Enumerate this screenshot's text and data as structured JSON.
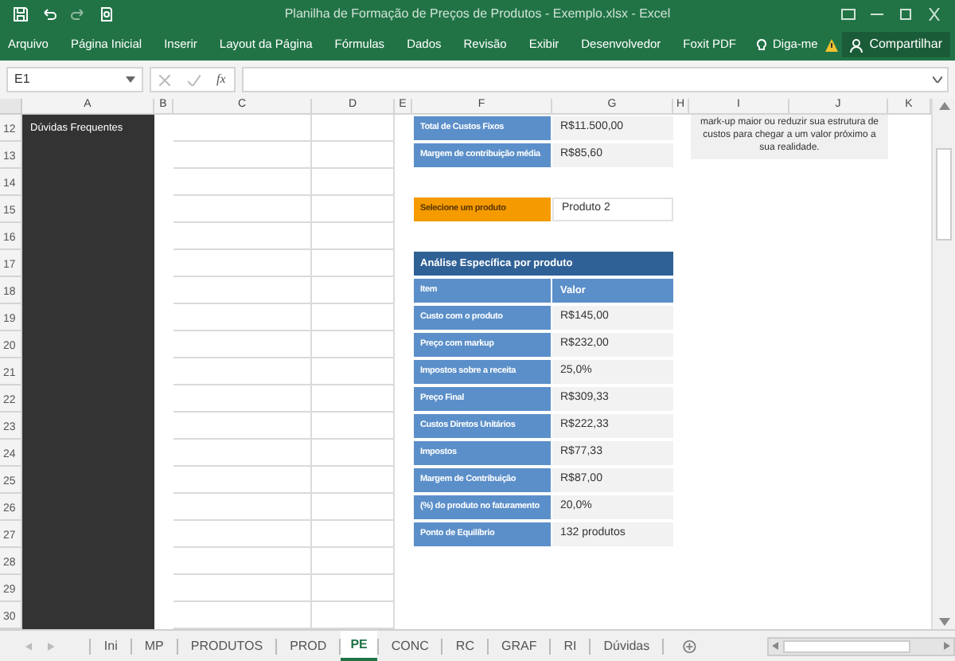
{
  "window": {
    "title": "Planilha de Formação de Preços de Produtos - Exemplo.xlsx - Excel"
  },
  "ribbon_tabs": [
    {
      "label": "Arquivo"
    },
    {
      "label": "Página Inicial"
    },
    {
      "label": "Inserir"
    },
    {
      "label": "Layout da Página"
    },
    {
      "label": "Fórmulas"
    },
    {
      "label": "Dados"
    },
    {
      "label": "Revisão"
    },
    {
      "label": "Exibir"
    },
    {
      "label": "Desenvolvedor"
    },
    {
      "label": "Foxit PDF"
    }
  ],
  "tell_me": "Diga-me",
  "share": "Compartilhar",
  "name_box": "E1",
  "fx": "fx",
  "columns": [
    "A",
    "B",
    "C",
    "D",
    "E",
    "F",
    "G",
    "H",
    "I",
    "J",
    "K"
  ],
  "rows": [
    "12",
    "13",
    "14",
    "15",
    "16",
    "17",
    "18",
    "19",
    "20",
    "21",
    "22",
    "23",
    "24",
    "25",
    "26",
    "27",
    "28",
    "29",
    "30"
  ],
  "sidebar_label": "Dúvidas Frequentes",
  "summary": [
    {
      "label": "Total de Custos Fixos",
      "value": "R$11.500,00"
    },
    {
      "label": "Margem de contribuição média",
      "value": "R$85,60"
    }
  ],
  "product_select": {
    "label": "Selecione um produto",
    "value": "Produto 2"
  },
  "analysis": {
    "title": "Análise Específica por produto",
    "header": [
      "Item",
      "Valor"
    ],
    "rows": [
      {
        "label": "Custo com o produto",
        "value": "R$145,00"
      },
      {
        "label": "Preço com markup",
        "value": "R$232,00"
      },
      {
        "label": "Impostos sobre a receita",
        "value": "25,0%"
      },
      {
        "label": "Preço Final",
        "value": "R$309,33"
      },
      {
        "label": "Custos Diretos Unitários",
        "value": "R$222,33"
      },
      {
        "label": "Impostos",
        "value": "R$77,33"
      },
      {
        "label": "Margem de Contribuição",
        "value": "R$87,00"
      },
      {
        "label": "(%) do produto no faturamento",
        "value": "20,0%"
      },
      {
        "label": "Ponto de Equilíbrio",
        "value": "132 produtos"
      }
    ]
  },
  "note": "mark-up maior ou reduzir sua estrutura de custos para chegar a um valor próximo a sua realidade.",
  "sheet_tabs": [
    {
      "label": "Ini",
      "selected": false
    },
    {
      "label": "MP",
      "selected": false
    },
    {
      "label": "PRODUTOS",
      "selected": false
    },
    {
      "label": "PROD",
      "selected": false
    },
    {
      "label": "PE",
      "selected": true
    },
    {
      "label": "CONC",
      "selected": false
    },
    {
      "label": "RC",
      "selected": false
    },
    {
      "label": "GRAF",
      "selected": false
    },
    {
      "label": "RI",
      "selected": false
    },
    {
      "label": "Dúvidas",
      "selected": false
    }
  ]
}
